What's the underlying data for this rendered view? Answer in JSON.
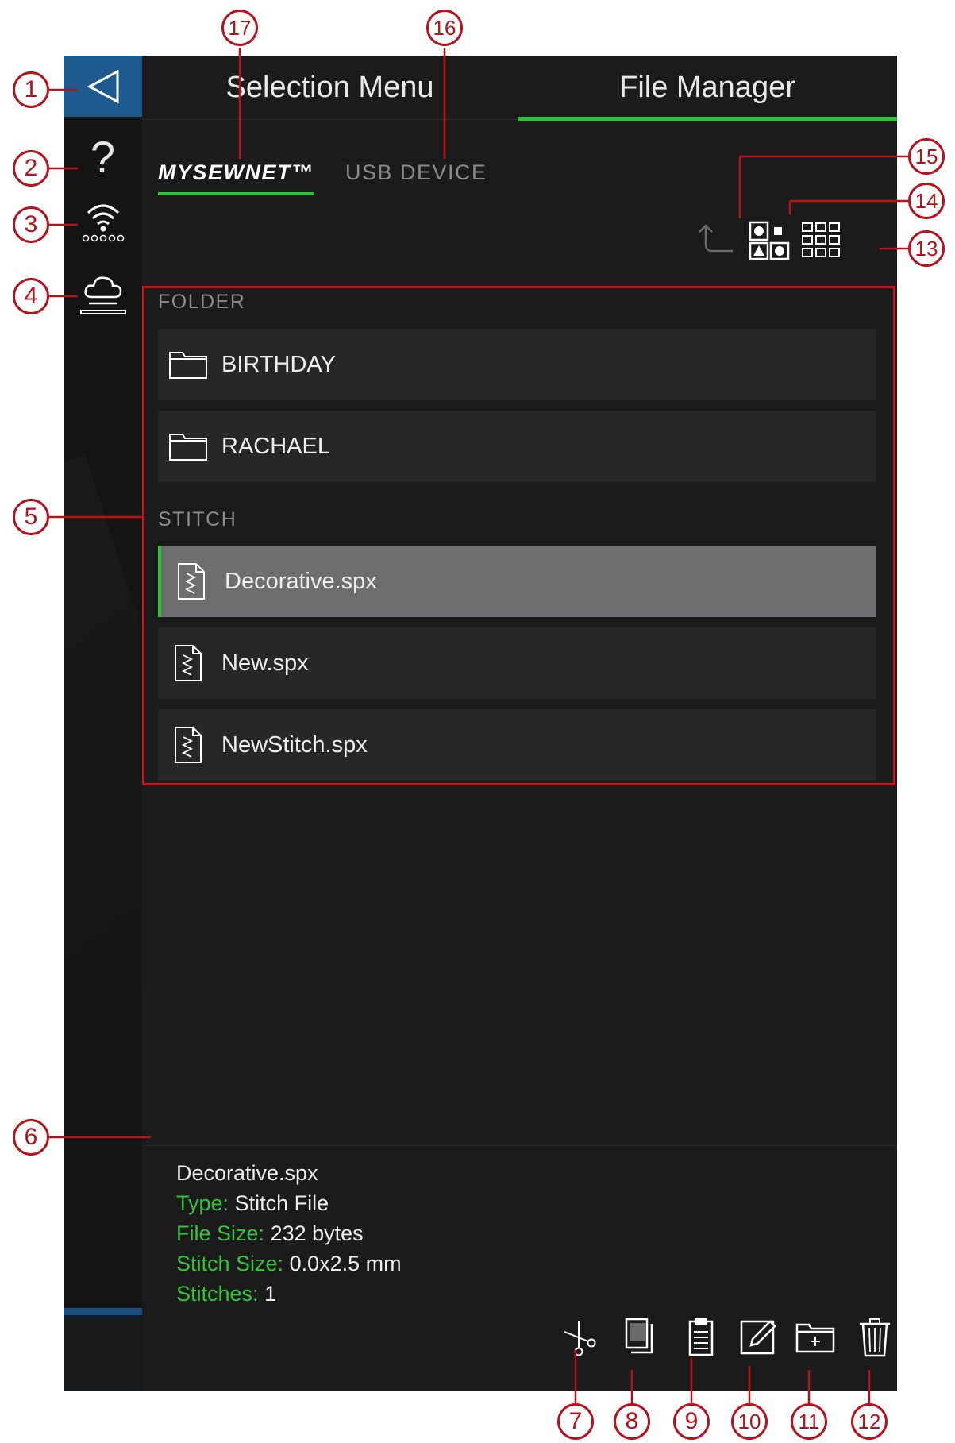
{
  "header": {
    "tabs": [
      {
        "label": "Selection Menu",
        "active": false
      },
      {
        "label": "File Manager",
        "active": true
      }
    ]
  },
  "sources": {
    "tabs": [
      {
        "label": "MYSEWNET™",
        "active": true
      },
      {
        "label": "USB DEVICE",
        "active": false
      }
    ]
  },
  "sidebar": {
    "icons": [
      "back-arrow-icon",
      "help-icon",
      "wifi-icon",
      "cloud-sync-icon"
    ],
    "help_glyph": "?"
  },
  "view_controls": [
    "folder-up-icon",
    "large-thumbnails-icon",
    "small-thumbnails-icon"
  ],
  "file_list": {
    "folder_heading": "FOLDER",
    "folders": [
      {
        "name": "BIRTHDAY"
      },
      {
        "name": "RACHAEL"
      }
    ],
    "stitch_heading": "STITCH",
    "files": [
      {
        "name": "Decorative.spx",
        "selected": true
      },
      {
        "name": "New.spx",
        "selected": false
      },
      {
        "name": "NewStitch.spx",
        "selected": false
      }
    ]
  },
  "info": {
    "filename": "Decorative.spx",
    "type_label": "Type:",
    "type_value": "Stitch File",
    "size_label": "File Size:",
    "size_value": "232 bytes",
    "stitch_size_label": "Stitch Size:",
    "stitch_size_value": "0.0x2.5 mm",
    "stitches_label": "Stitches:",
    "stitches_value": "1"
  },
  "actions": [
    "cut-icon",
    "copy-icon",
    "paste-icon",
    "rename-icon",
    "new-folder-icon",
    "delete-icon"
  ],
  "callouts": [
    "1",
    "2",
    "3",
    "4",
    "5",
    "6",
    "7",
    "8",
    "9",
    "10",
    "11",
    "12",
    "13",
    "14",
    "15",
    "16",
    "17"
  ],
  "colors": {
    "accent_green": "#2fc13c",
    "back_button_blue": "#1d5b8f",
    "callout_red": "#b5121b",
    "background": "#1b1b1c",
    "row": "#272728",
    "row_selected": "#6e6e71"
  }
}
